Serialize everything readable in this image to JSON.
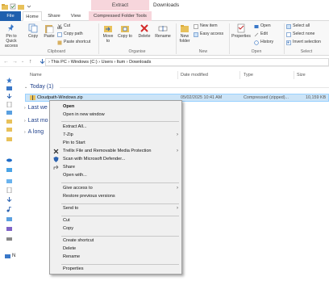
{
  "window": {
    "context_tab_header": "Extract",
    "title": "Downloads"
  },
  "tabs": {
    "file": "File",
    "home": "Home",
    "share": "Share",
    "view": "View",
    "compressed": "Compressed Folder Tools"
  },
  "ribbon": {
    "pin_quick_access": "Pin to Quick access",
    "copy": "Copy",
    "paste": "Paste",
    "cut": "Cut",
    "copy_path": "Copy path",
    "paste_shortcut": "Paste shortcut",
    "move_to": "Move to",
    "copy_to": "Copy to",
    "delete": "Delete",
    "rename": "Rename",
    "new_folder": "New folder",
    "new_item": "New item",
    "easy_access": "Easy access",
    "properties": "Properties",
    "open": "Open",
    "edit": "Edit",
    "history": "History",
    "select_all": "Select all",
    "select_none": "Select none",
    "invert_selection": "Invert selection",
    "group_clipboard": "Clipboard",
    "group_organise": "Organise",
    "group_new": "New",
    "group_open": "Open",
    "group_select": "Select"
  },
  "address": {
    "path": "›  This PC  ›  Windows (C:)  ›  Users  ›  ltum  ›  Downloads"
  },
  "columns": {
    "name": "Name",
    "date_modified": "Date modified",
    "type": "Type",
    "size": "Size"
  },
  "groups": {
    "today": "Today (1)",
    "last_week": "Last we",
    "last_month": "Last mo",
    "long_ago": "A long"
  },
  "file": {
    "name": "Cloudpath-Windows.zip",
    "date": "05/02/2025 10:41 AM",
    "type": "Compressed (zipped)...",
    "size": "10,159 KB"
  },
  "nav": {
    "network_abbrev": "N"
  },
  "menu": {
    "open": "Open",
    "open_new_window": "Open in new window",
    "extract_all": "Extract All...",
    "seven_zip": "7-Zip",
    "pin_to_start": "Pin to Start",
    "trellix": "Trellix File and Removable Media Protection",
    "scan_defender": "Scan with Microsoft Defender...",
    "share": "Share",
    "open_with": "Open with...",
    "give_access": "Give access to",
    "restore_versions": "Restore previous versions",
    "send_to": "Send to",
    "cut": "Cut",
    "copy": "Copy",
    "create_shortcut": "Create shortcut",
    "delete": "Delete",
    "rename": "Rename",
    "properties": "Properties",
    "submenu_arrow": "›"
  },
  "colors": {
    "file_tab": "#1f5fae",
    "context_header": "#f7d6dc",
    "selection": "#cce4f7",
    "group_text": "#1e3f8a"
  }
}
